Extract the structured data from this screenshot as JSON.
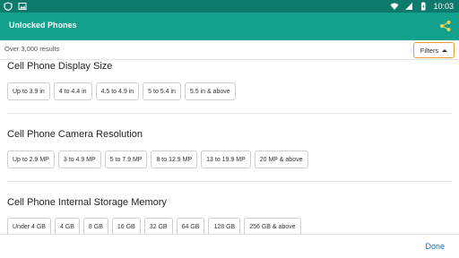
{
  "status_bar": {
    "time": "10:03",
    "icons": [
      "vpn-shield-icon",
      "image-icon",
      "wifi-icon",
      "signal-icon",
      "battery-charging-icon"
    ]
  },
  "app_bar": {
    "title": "Unlocked Phones",
    "share_icon": "share-icon",
    "color": "#13a08d"
  },
  "results": {
    "count_text": "Over 3,000 results",
    "filters_label": "Filters",
    "filters_border_color": "#e79b3c"
  },
  "sections": [
    {
      "title": "Cell Phone Display Size",
      "options": [
        "Up to 3.9 in",
        "4 to 4.4 in",
        "4.5 to 4.9 in",
        "5 to 5.4 in",
        "5.5 in & above"
      ]
    },
    {
      "title": "Cell Phone Camera Resolution",
      "options": [
        "Up to 2.9 MP",
        "3 to 4.9 MP",
        "5 to 7.9 MP",
        "8 to 12.9 MP",
        "13 to 19.9 MP",
        "20 MP & above"
      ]
    },
    {
      "title": "Cell Phone Internal Storage Memory",
      "options": [
        "Under 4 GB",
        "4 GB",
        "8 GB",
        "16 GB",
        "32 GB",
        "64 GB",
        "128 GB",
        "256 GB & above"
      ]
    }
  ],
  "footer": {
    "done_label": "Done",
    "done_color": "#1a6fb5"
  }
}
